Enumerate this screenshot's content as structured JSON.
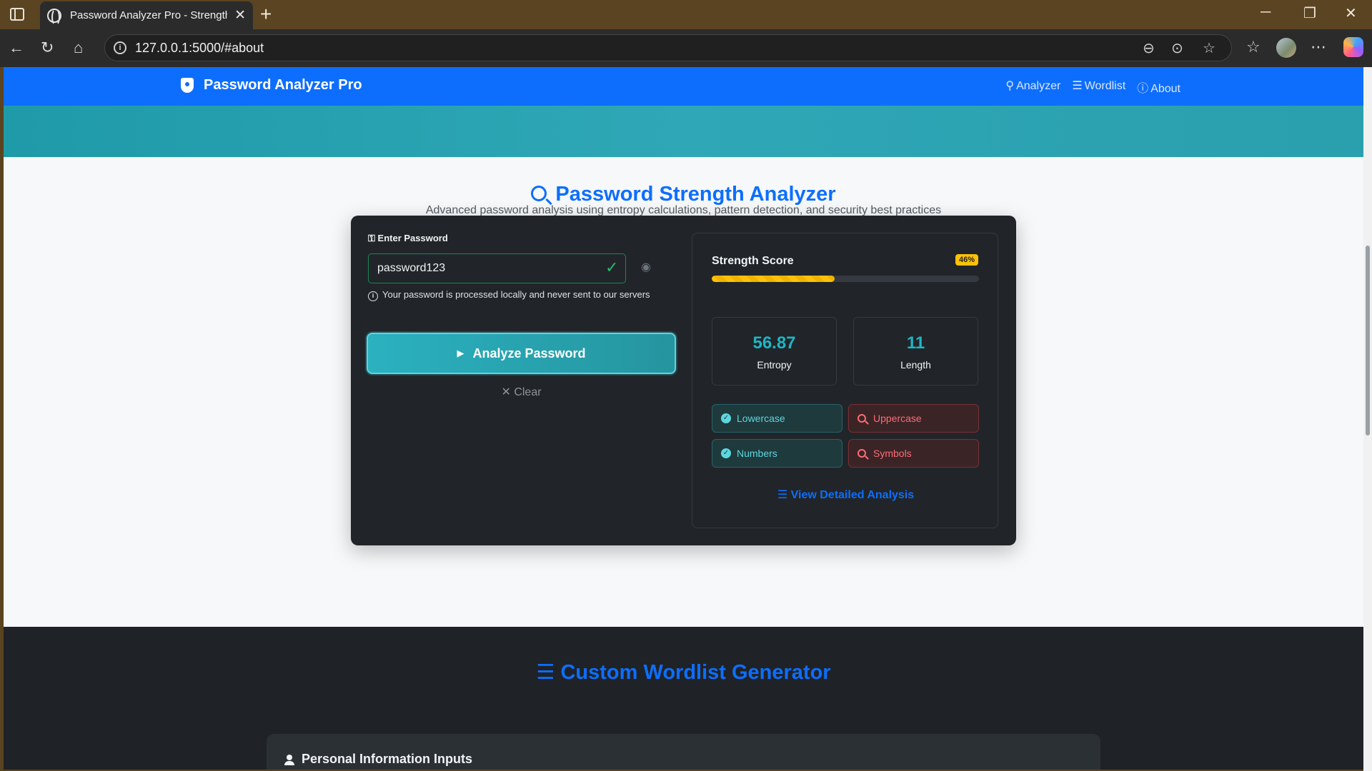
{
  "browser": {
    "tab_title": "Password Analyzer Pro - Strength",
    "url": "127.0.0.1:5000/#about"
  },
  "navbar": {
    "brand": "Password Analyzer Pro",
    "links": [
      "Analyzer",
      "Wordlist",
      "About"
    ]
  },
  "analyzer": {
    "title": "Password Strength Analyzer",
    "subtitle": "Advanced password analysis using entropy calculations, pattern detection, and security best practices",
    "input_label": "Enter Password",
    "password_value": "password123",
    "privacy_note": "Your password is processed locally and never sent to our servers",
    "analyze_label": "Analyze Password",
    "clear_label": "Clear",
    "score_label": "Strength Score",
    "score_percent": "46%",
    "score_fraction": 0.46,
    "entropy_value": "56.87",
    "entropy_label": "Entropy",
    "length_value": "11",
    "length_label": "Length",
    "requirements": [
      {
        "label": "Lowercase",
        "status": "pass"
      },
      {
        "label": "Uppercase",
        "status": "fail"
      },
      {
        "label": "Numbers",
        "status": "pass"
      },
      {
        "label": "Symbols",
        "status": "fail"
      }
    ],
    "detail_link": "View Detailed Analysis"
  },
  "wordlist": {
    "title": "Custom Wordlist Generator",
    "card_heading": "Personal Information Inputs"
  },
  "colors": {
    "primary": "#0d6efd",
    "teal": "#20b5c4",
    "warning": "#ffc107",
    "danger": "#ff6b76",
    "success": "#198754"
  }
}
